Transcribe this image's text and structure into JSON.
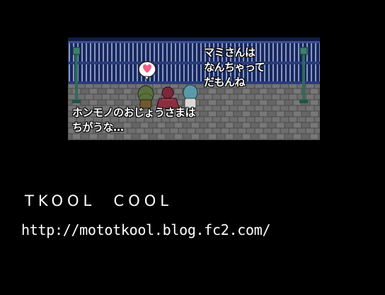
{
  "scene": {
    "speech_right": [
      "マミさんは",
      "なんちゃって",
      "だもんね"
    ],
    "speech_left": [
      "ホンモノのおじょうさまは",
      "ちがうな…"
    ],
    "heart_icon": "heart-icon",
    "colors": {
      "fence_blue": "#1a2e6a",
      "bar_light": "#8f9bc3",
      "lamp_green": "#2f6b5a",
      "heart_pink": "#f06088"
    }
  },
  "footer": {
    "title": "TKOOL  COOL",
    "url": "http://mototkool.blog.fc2.com/"
  }
}
